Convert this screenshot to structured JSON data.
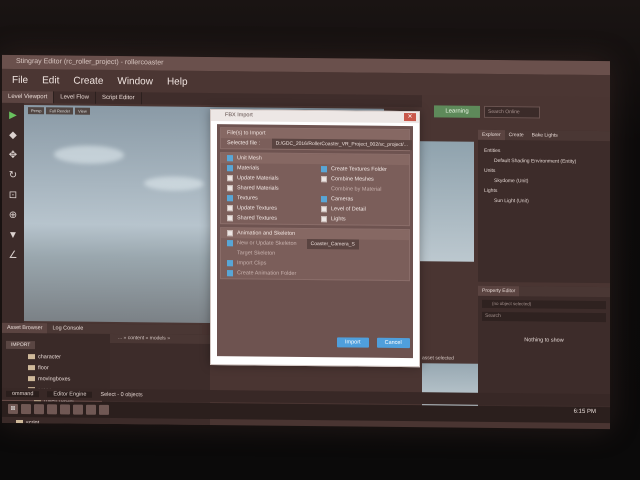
{
  "window": {
    "title": "Stingray Editor (rc_roller_project) - rollercoaster"
  },
  "menu": [
    "File",
    "Edit",
    "Create",
    "Window",
    "Help"
  ],
  "tabs": [
    "Level Viewport",
    "Level Flow",
    "Script Editor"
  ],
  "viewport_buttons": [
    "Persp",
    "Full Render",
    "View"
  ],
  "learning": "Learning",
  "top_search_placeholder": "Search Online",
  "explorer": {
    "tabs": [
      "Explorer",
      "Create",
      "Bake Lights"
    ],
    "items": [
      "Entities",
      "Default Shading Environment (Entity)",
      "Units",
      "Skydome (Unit)",
      "Lights",
      "Sun Light (Unit)"
    ]
  },
  "property_editor": {
    "title": "Property Editor",
    "filter": "(no object selected)",
    "search": "Search",
    "empty": "Nothing to show"
  },
  "asset_browser": {
    "tabs": [
      "Asset Browser",
      "Log Console"
    ],
    "import": "IMPORT",
    "folders": [
      "character",
      "floor",
      "movingboxes",
      "props",
      "rollercoaster",
      "ui",
      "script"
    ],
    "selected": "rollercoaster",
    "breadcrumb": "... » content » models »"
  },
  "asset_selected_text": "asset selected",
  "statusbar": {
    "command": "ommand",
    "engine": "Editor Engine",
    "selection": "Select - 0 objects"
  },
  "clock": "6:15 PM",
  "dialog": {
    "title": "FBX Import",
    "files_section": "File(s) to Import",
    "selected_file_label": "Selected file :",
    "selected_file_value": "D:/GDC_2016/RollerCoaster_VR_Project_002/sc_project/...",
    "unit_mesh": "Unit Mesh",
    "left_options": [
      "Materials",
      "Update Materials",
      "Shared Materials",
      "Textures",
      "Update Textures",
      "Shared Textures"
    ],
    "right_options": [
      "Create Textures Folder",
      "Combine Meshes",
      "Combine by Material",
      "Cameras",
      "Level of Detail",
      "Lights"
    ],
    "animation_section": "Animation and Skeleton",
    "new_skeleton_label": "New or Update Skeleton",
    "new_skeleton_value": "Coaster_Camera_S",
    "target_skeleton": "Target Skeleton",
    "import_clips": "Import Clips",
    "create_anim_folder": "Create Animation Folder",
    "import_button": "Import",
    "cancel_button": "Cancel"
  }
}
